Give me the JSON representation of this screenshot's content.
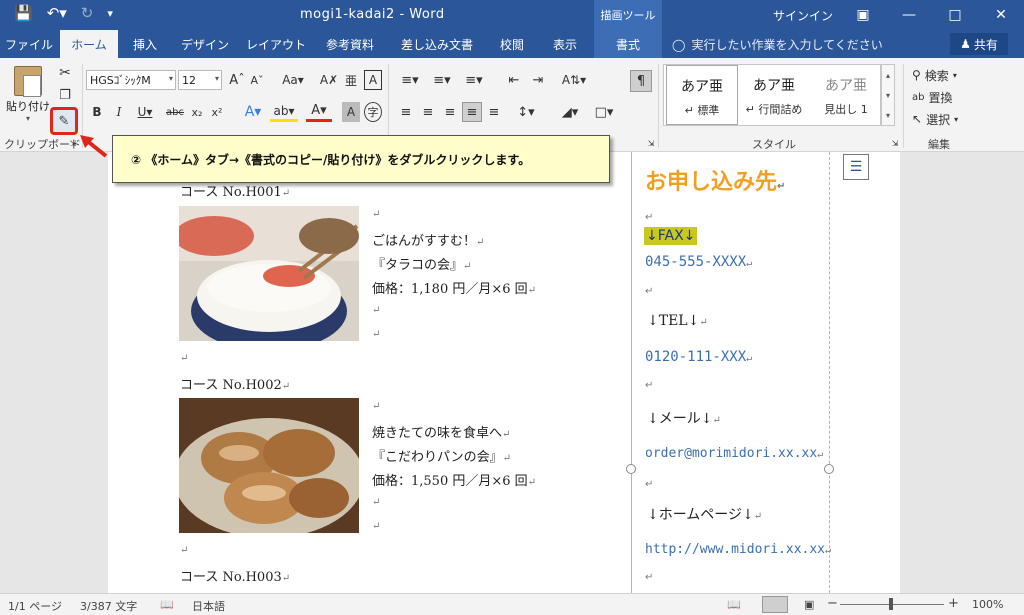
{
  "titlebar": {
    "title": "mogi1-kadai2  -  Word",
    "context_group": "描画ツール",
    "signin": "サインイン"
  },
  "tabs": [
    "ファイル",
    "ホーム",
    "挿入",
    "デザイン",
    "レイアウト",
    "参考資料",
    "差し込み文書",
    "校閲",
    "表示",
    "書式"
  ],
  "tellme": "実行したい作業を入力してください",
  "share": "共有",
  "ribbon": {
    "paste_label": "貼り付け",
    "clipboard_label": "クリップボード",
    "font_name": "HGSｺﾞｼｯｸM",
    "font_size": "12",
    "styles_label": "スタイル",
    "styles": [
      {
        "sample": "あア亜",
        "name": "↵ 標準"
      },
      {
        "sample": "あア亜",
        "name": "↵ 行間詰め"
      },
      {
        "sample": "あア亜",
        "name": "見出し 1"
      }
    ],
    "edit_label": "編集",
    "find": "検索",
    "replace": "置換",
    "select": "選択"
  },
  "callout": "② 《ホーム》タブ→《書式のコピー/貼り付け》をダブルクリックします。",
  "document": {
    "course1": "コース No.H001",
    "course1_lines": [
      "ごはんがすすむ！",
      "『タラコの会』",
      "価格：1,180 円／月×6 回"
    ],
    "course2": "コース No.H002",
    "course2_lines": [
      "焼きたての味を食卓へ",
      "『こだわりパンの会』",
      "価格：1,550 円／月×6 回"
    ],
    "course3": "コース No.H003"
  },
  "sidebar": {
    "heading": "お申し込み先",
    "fax_label": "↓FAX↓",
    "fax": "045-555-XXXX",
    "tel_label": "↓TEL↓",
    "tel": "0120-111-XXX",
    "mail_label": "↓メール↓",
    "mail": "order@morimidori.xx.xx",
    "web_label": "↓ホームページ↓",
    "web": "http://www.midori.xx.xx"
  },
  "status": {
    "page": "1/1 ページ",
    "words": "3/387 文字",
    "language": "日本語",
    "zoom": "100%"
  },
  "colors": {
    "word_blue": "#2b579a",
    "highlight_red": "#e0261b",
    "heading_orange": "#f0a020"
  }
}
